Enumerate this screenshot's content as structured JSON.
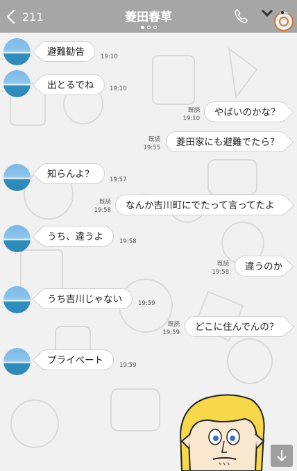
{
  "header": {
    "back_count": "211",
    "title": "菱田春草"
  },
  "messages": [
    {
      "side": "in",
      "text": "避難勧告",
      "time": "19:10"
    },
    {
      "side": "in",
      "text": "出とるでね",
      "time": "19:10"
    },
    {
      "side": "out",
      "text": "やばいのかな？",
      "read": "既読",
      "time": "19:10"
    },
    {
      "side": "out",
      "text": "菱田家にも避難でたら？",
      "read": "既読",
      "time": "19:55"
    },
    {
      "side": "in",
      "text": "知らんよ？",
      "time": "19:57"
    },
    {
      "side": "out",
      "text": "なんか吉川町にでたって言ってたよ",
      "read": "既読",
      "time": "19:58"
    },
    {
      "side": "in",
      "text": "うち、違うよ",
      "time": "19:58"
    },
    {
      "side": "out",
      "text": "違うのか",
      "read": "既読",
      "time": "19:58"
    },
    {
      "side": "in",
      "text": "うち吉川じゃない",
      "time": "19:59"
    },
    {
      "side": "out",
      "text": "どこに住んでんの？",
      "read": "既読",
      "time": "19:59"
    },
    {
      "side": "in",
      "text": "プライベート",
      "time": "19:59"
    }
  ],
  "icons": {
    "back": "chevron-left-icon",
    "call": "phone-icon",
    "menu": "chevron-down-icon",
    "scroll": "arrow-down-icon"
  },
  "colors": {
    "header": "#a6a6a6",
    "bubble": "#ffffff",
    "background": "#f1f1f1"
  }
}
